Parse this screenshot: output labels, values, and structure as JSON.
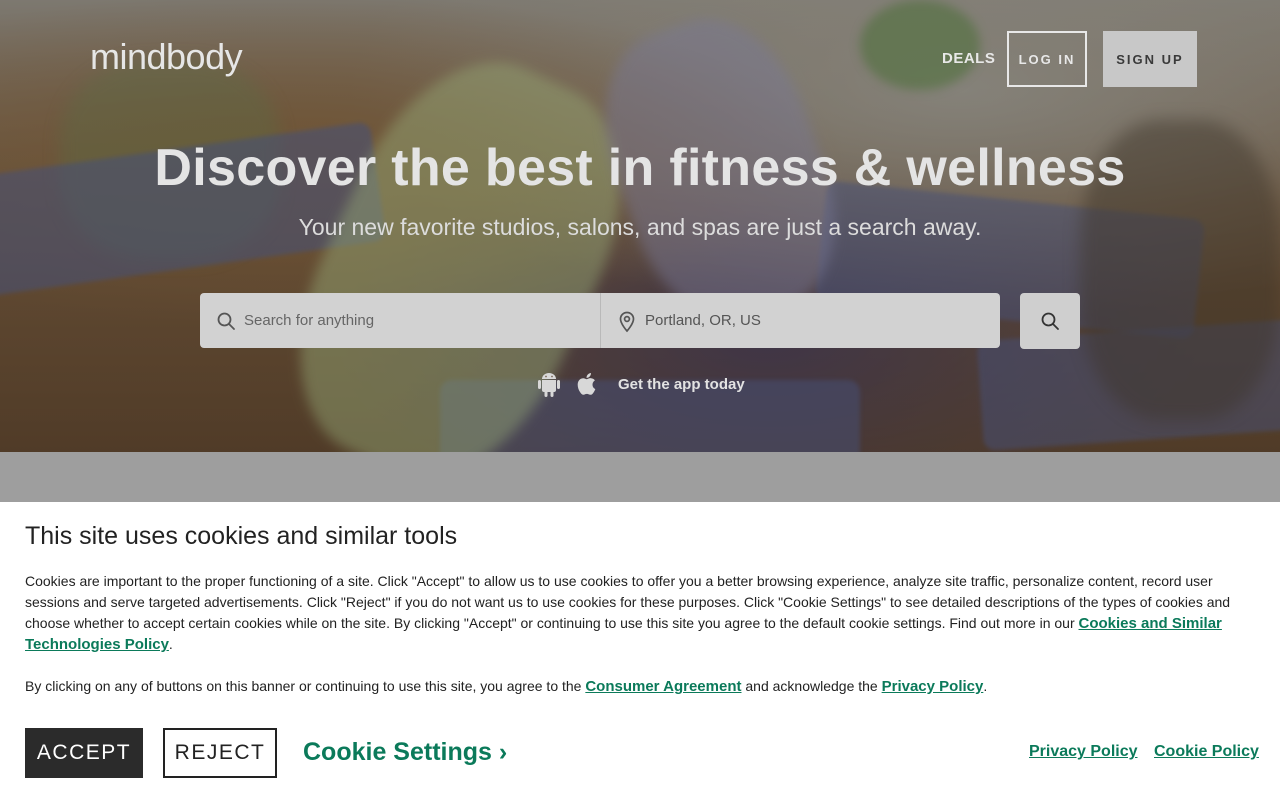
{
  "header": {
    "logo": "mindbody",
    "nav": {
      "deals": "DEALS"
    },
    "login_label": "LOG IN",
    "signup_label": "SIGN UP"
  },
  "hero": {
    "title": "Discover the best in fitness & wellness",
    "subtitle": "Your new favorite studios, salons, and spas are just a search away.",
    "search": {
      "query_placeholder": "Search for anything",
      "location_value": "Portland, OR, US",
      "query_icon": "search-icon",
      "location_icon": "location-pin-icon",
      "button_icon": "search-icon"
    },
    "app": {
      "text": "Get the app today",
      "icons": [
        "android-icon",
        "apple-icon"
      ]
    }
  },
  "cookie_banner": {
    "title": "This site uses cookies and similar tools",
    "body": "Cookies are important to the proper functioning of a site. Click \"Accept\" to allow us to use cookies to offer you a better browsing experience, analyze site traffic, personalize content, record user sessions and serve targeted advertisements. Click \"Reject\" if you do not want us to use cookies for these purposes. Click \"Cookie Settings\" to see detailed descriptions of the types of cookies and choose whether to accept certain cookies while on the site. By clicking \"Accept\" or continuing to use this site you agree to the default cookie settings. Find out more in our",
    "policy_link": "Cookies and Similar Technologies Policy",
    "body_end": ".",
    "agreement_prefix": "By clicking on any of buttons on this banner or continuing to use this site, you agree to the",
    "consumer_agreement": "Consumer Agreement",
    "agreement_middle": "and acknowledge the",
    "privacy_policy_inline": "Privacy Policy",
    "agreement_end": ".",
    "accept_label": "ACCEPT",
    "reject_label": "REJECT",
    "settings_label": "Cookie Settings ›",
    "footer_links": [
      "Privacy Policy",
      "Cookie Policy"
    ]
  },
  "colors": {
    "accent_green": "#0b7a5a",
    "accept_bg": "#2b2b2b"
  }
}
